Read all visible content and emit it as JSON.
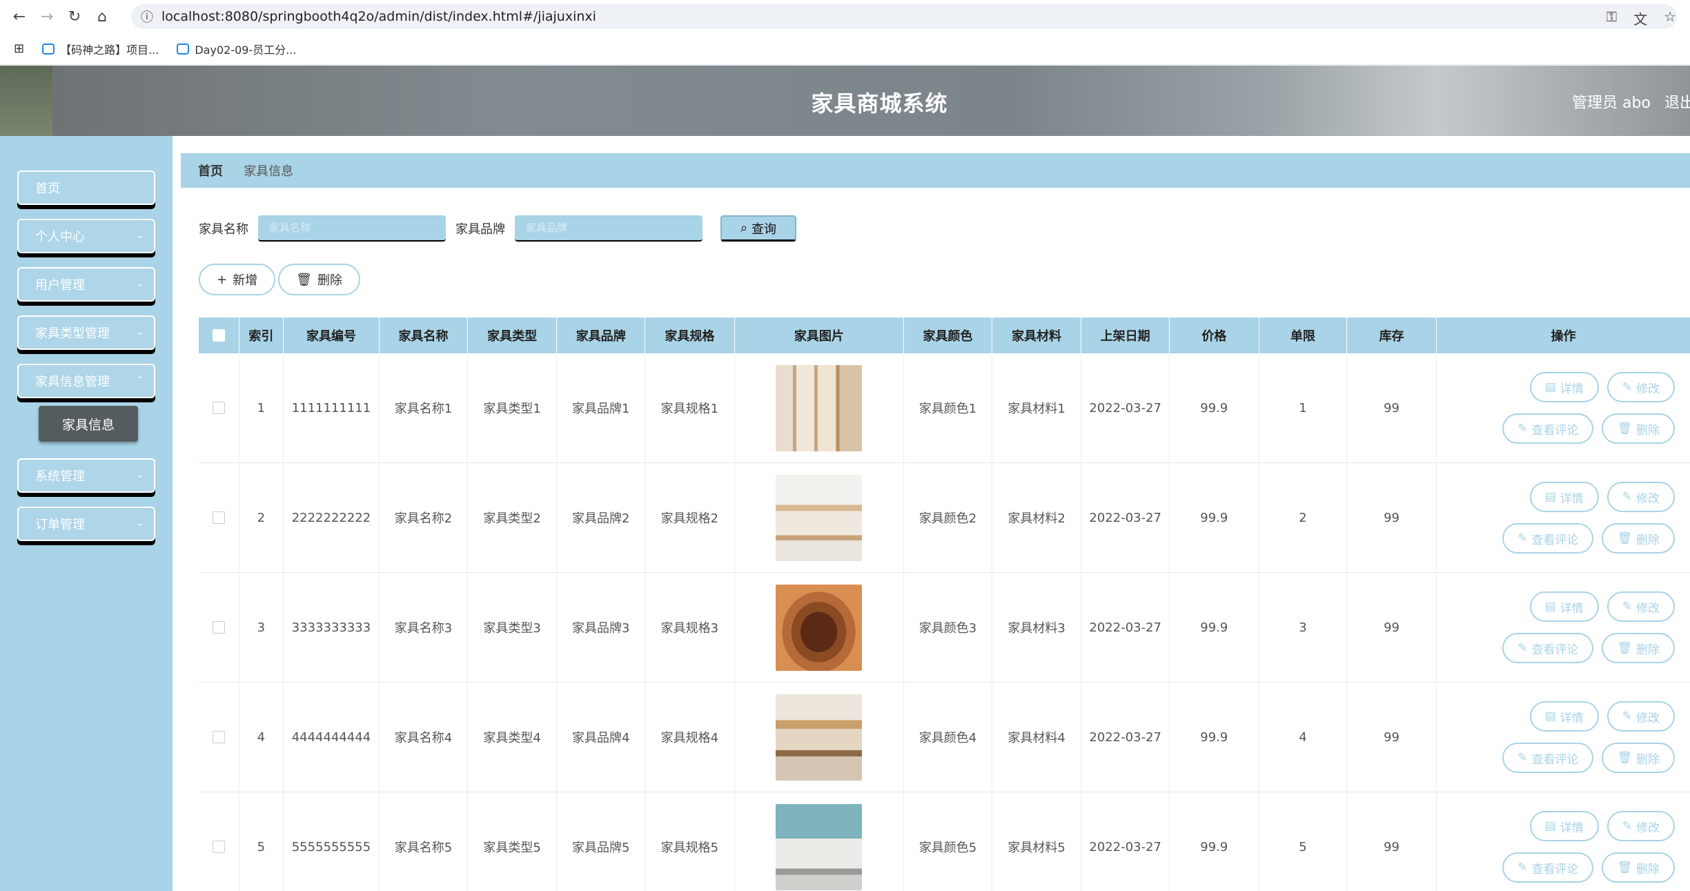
{
  "browser": {
    "url": "localhost:8080/springbooth4q2o/admin/dist/index.html#/jiajuxinxi",
    "bookmarks": [
      "【码神之路】项目...",
      "Day02-09-员工分..."
    ]
  },
  "header": {
    "title": "家具商城系统",
    "admin_label": "管理员 abo",
    "logout_label": "退出"
  },
  "sidebar": {
    "items": [
      {
        "label": "首页"
      },
      {
        "label": "个人中心"
      },
      {
        "label": "用户管理"
      },
      {
        "label": "家具类型管理"
      },
      {
        "label": "家具信息管理"
      },
      {
        "label": "系统管理"
      },
      {
        "label": "订单管理"
      }
    ],
    "sub_active": "家具信息"
  },
  "breadcrumb": {
    "home": "首页",
    "current": "家具信息"
  },
  "search": {
    "name_label": "家具名称",
    "name_placeholder": "家具名称",
    "brand_label": "家具品牌",
    "brand_placeholder": "家具品牌",
    "query_label": "查询"
  },
  "actions": {
    "add_label": "新增",
    "delete_label": "删除"
  },
  "table": {
    "headers": [
      "索引",
      "家具编号",
      "家具名称",
      "家具类型",
      "家具品牌",
      "家具规格",
      "家具图片",
      "家具颜色",
      "家具材料",
      "上架日期",
      "价格",
      "单限",
      "库存",
      "操作"
    ],
    "op_labels": {
      "detail": "详情",
      "edit": "修改",
      "review": "查看评论",
      "delete": "删除"
    },
    "rows": [
      {
        "index": "1",
        "code": "1111111111",
        "name": "家具名称1",
        "type": "家具类型1",
        "brand": "家具品牌1",
        "spec": "家具规格1",
        "color": "家具颜色1",
        "material": "家具材料1",
        "date": "2022-03-27",
        "price": "99.9",
        "limit": "1",
        "stock": "99"
      },
      {
        "index": "2",
        "code": "2222222222",
        "name": "家具名称2",
        "type": "家具类型2",
        "brand": "家具品牌2",
        "spec": "家具规格2",
        "color": "家具颜色2",
        "material": "家具材料2",
        "date": "2022-03-27",
        "price": "99.9",
        "limit": "2",
        "stock": "99"
      },
      {
        "index": "3",
        "code": "3333333333",
        "name": "家具名称3",
        "type": "家具类型3",
        "brand": "家具品牌3",
        "spec": "家具规格3",
        "color": "家具颜色3",
        "material": "家具材料3",
        "date": "2022-03-27",
        "price": "99.9",
        "limit": "3",
        "stock": "99"
      },
      {
        "index": "4",
        "code": "4444444444",
        "name": "家具名称4",
        "type": "家具类型4",
        "brand": "家具品牌4",
        "spec": "家具规格4",
        "color": "家具颜色4",
        "material": "家具材料4",
        "date": "2022-03-27",
        "price": "99.9",
        "limit": "4",
        "stock": "99"
      },
      {
        "index": "5",
        "code": "5555555555",
        "name": "家具名称5",
        "type": "家具类型5",
        "brand": "家具品牌5",
        "spec": "家具规格5",
        "color": "家具颜色5",
        "material": "家具材料5",
        "date": "2022-03-27",
        "price": "99.9",
        "limit": "5",
        "stock": "99"
      }
    ]
  },
  "colors": {
    "accent": "#a9d3e6",
    "header_bg": "#7b858a"
  }
}
